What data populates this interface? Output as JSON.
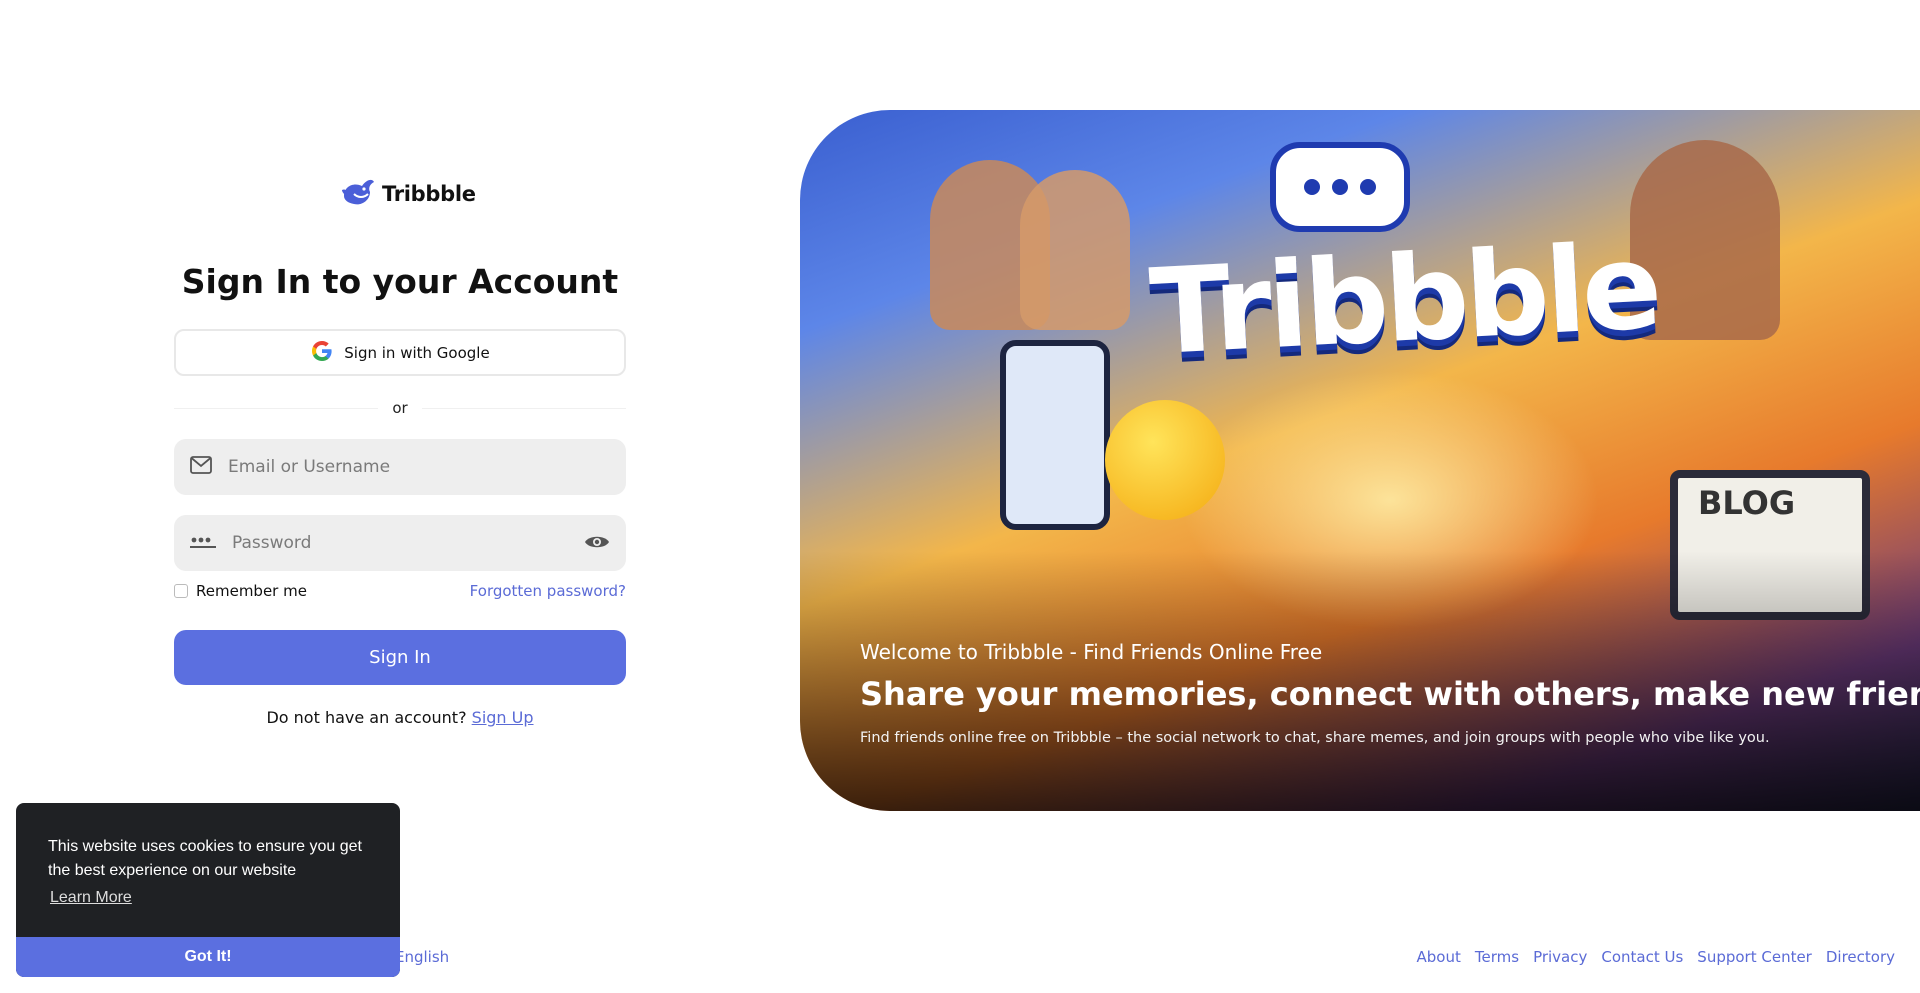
{
  "brand": {
    "name": "Tribbble",
    "logo_icon": "whale-logo-icon",
    "accent": "#5b6fe0"
  },
  "signin_form": {
    "title": "Sign In to your Account",
    "google_label": "Sign in with Google",
    "divider_text": "or",
    "email_placeholder": "Email or Username",
    "password_placeholder": "Password",
    "remember_label": "Remember me",
    "forgot_label": "Forgotten password?",
    "submit_label": "Sign In",
    "no_account_text": "Do not have an account?",
    "signup_label": "Sign Up"
  },
  "hero": {
    "image_brand": "Tribbble",
    "laptop_text": "BLOG",
    "subtitle": "Welcome to Tribbble - Find Friends Online Free",
    "headline": "Share your memories, connect with others, make new friends",
    "description": "Find friends online free on Tribbble – the social network to chat, share memes, and join groups with people who vibe like you."
  },
  "footer": {
    "language": "English",
    "links": [
      "About",
      "Terms",
      "Privacy",
      "Contact Us",
      "Support Center",
      "Directory"
    ]
  },
  "cookie_banner": {
    "message": "This website uses cookies to ensure you get the best experience on our website",
    "learn_more": "Learn More",
    "accept": "Got It!"
  }
}
